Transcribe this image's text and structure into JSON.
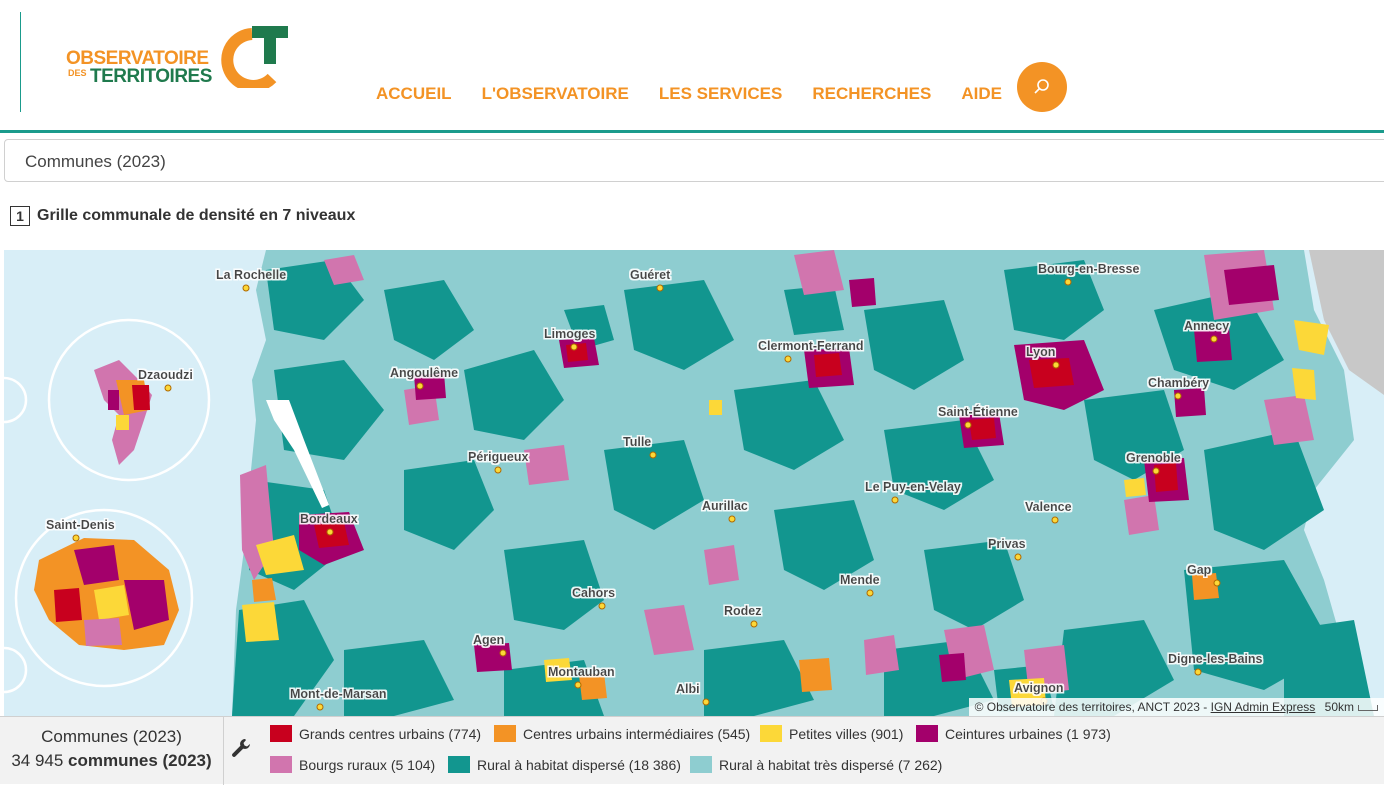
{
  "header": {
    "logo_line1": "OBSERVATOIRE",
    "logo_des": "DES",
    "logo_line2": "TERRITOIRES",
    "nav": [
      "ACCUEIL",
      "L'OBSERVATOIRE",
      "LES SERVICES",
      "RECHERCHES",
      "AIDE"
    ]
  },
  "selector": {
    "value": "Communes (2023)"
  },
  "map_title": {
    "number": "1",
    "text": "Grille communale de densité en 7 niveaux"
  },
  "map": {
    "cities": [
      "La Rochelle",
      "Guéret",
      "Bourg-en-Bresse",
      "Limoges",
      "Clermont-Ferrand",
      "Annecy",
      "Dzaoudzi",
      "Angoulême",
      "Lyon",
      "Chambéry",
      "Saint-Étienne",
      "Tulle",
      "Périgueux",
      "Grenoble",
      "Aurillac",
      "Le Puy-en-Velay",
      "Saint-Denis",
      "Bordeaux",
      "Valence",
      "Privas",
      "Mende",
      "Gap",
      "Cahors",
      "Rodez",
      "Agen",
      "Digne-les-Bains",
      "Montauban",
      "Avignon",
      "Albi",
      "Mont-de-Marsan"
    ],
    "attribution_text": "© Observatoire des territoires, ANCT 2023 - ",
    "attribution_link": "IGN Admin Express",
    "scale": "50km"
  },
  "legend": {
    "level_label": "Communes (2023)",
    "count": "34 945",
    "count_suffix": "communes (2023)",
    "items": [
      {
        "label": "Grands centres urbains (774)",
        "color": "#c8001e"
      },
      {
        "label": "Centres urbains intermédiaires (545)",
        "color": "#f39325"
      },
      {
        "label": "Petites villes (901)",
        "color": "#fcd838"
      },
      {
        "label": "Ceintures urbaines (1 973)",
        "color": "#a3006b"
      },
      {
        "label": "Bourgs ruraux (5 104)",
        "color": "#d175ae"
      },
      {
        "label": "Rural à habitat dispersé (18 386)",
        "color": "#12968f"
      },
      {
        "label": "Rural à habitat très dispersé (7 262)",
        "color": "#8ecdd0"
      }
    ]
  }
}
